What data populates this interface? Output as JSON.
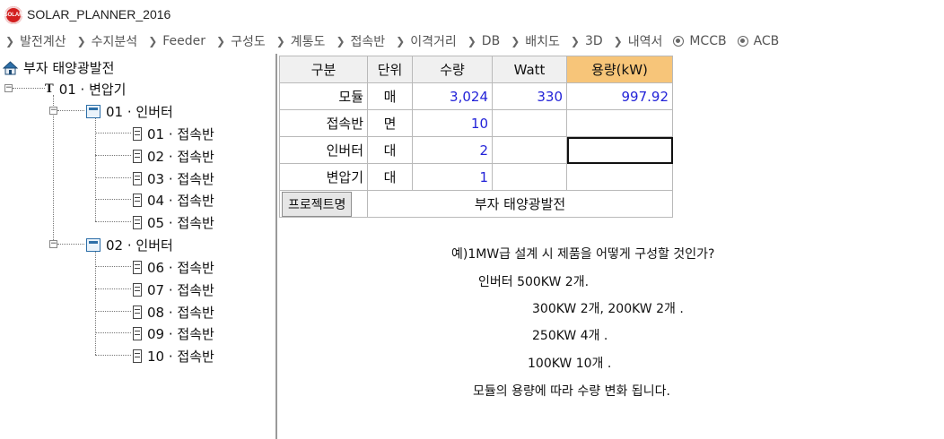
{
  "app": {
    "title": "SOLAR_PLANNER_2016",
    "logo_text": "SOLAR"
  },
  "menu": [
    {
      "label": "발전계산",
      "icon": "chevron-right-icon"
    },
    {
      "label": "수지분석",
      "icon": "chevron-right-icon"
    },
    {
      "label": "Feeder",
      "icon": "chevron-right-icon"
    },
    {
      "label": "구성도",
      "icon": "chevron-right-icon"
    },
    {
      "label": "계통도",
      "icon": "chevron-right-icon"
    },
    {
      "label": "접속반",
      "icon": "chevron-right-icon"
    },
    {
      "label": "이격거리",
      "icon": "chevron-right-icon"
    },
    {
      "label": "DB",
      "icon": "chevron-right-icon"
    },
    {
      "label": "배치도",
      "icon": "chevron-right-icon"
    },
    {
      "label": "3D",
      "icon": "chevron-right-icon"
    },
    {
      "label": "내역서",
      "icon": "chevron-right-icon"
    },
    {
      "label": "MCCB",
      "icon": "radio-icon"
    },
    {
      "label": "ACB",
      "icon": "radio-icon"
    }
  ],
  "tree": {
    "root": "부자 태양광발전",
    "transformer": "01 · 변압기",
    "inverters": [
      {
        "label": "01 · 인버터",
        "boxes": [
          "01 · 접속반",
          "02 · 접속반",
          "03 · 접속반",
          "04 · 접속반",
          "05 · 접속반"
        ]
      },
      {
        "label": "02 · 인버터",
        "boxes": [
          "06 · 접속반",
          "07 · 접속반",
          "08 · 접속반",
          "09 · 접속반",
          "10 · 접속반"
        ]
      }
    ]
  },
  "grid": {
    "headers": [
      "구분",
      "단위",
      "수량",
      "Watt",
      "용량(kW)"
    ],
    "rows": [
      {
        "name": "모듈",
        "unit": "매",
        "qty": "3,024",
        "watt": "330",
        "capacity": "997.92"
      },
      {
        "name": "접속반",
        "unit": "면",
        "qty": "10",
        "watt": "",
        "capacity": ""
      },
      {
        "name": "인버터",
        "unit": "대",
        "qty": "2",
        "watt": "",
        "capacity": ""
      },
      {
        "name": "변압기",
        "unit": "대",
        "qty": "1",
        "watt": "",
        "capacity": ""
      }
    ],
    "project_button": "프로젝트명",
    "project_name": "부자 태양광발전"
  },
  "note": {
    "question": "예)1MW급 설계 시 제품을 어떻게 구성할 것인가?",
    "line1": "인버터  500KW 2개.",
    "line2": "300KW 2개, 200KW 2개 .",
    "line3": "250KW 4개 .",
    "line4": "100KW 10개 .",
    "line5": "모듈의 용량에 따라 수량 변화 됩니다."
  }
}
